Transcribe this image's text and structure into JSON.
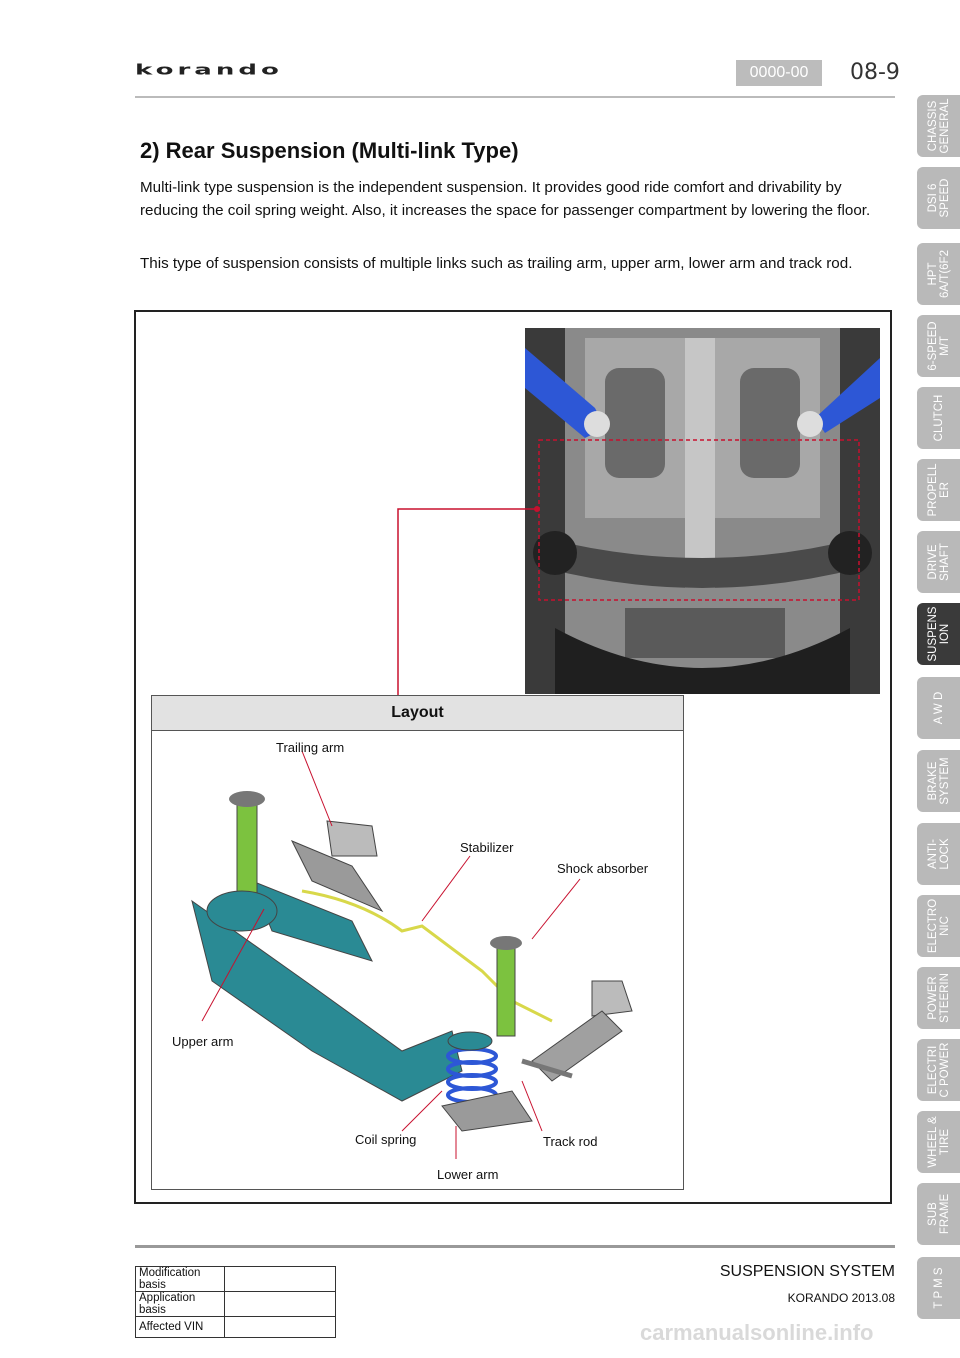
{
  "header": {
    "logo": "korando",
    "code": "0000-00",
    "page": "08-9"
  },
  "section": {
    "title": "2) Rear Suspension (Multi-link Type)",
    "para1": "Multi-link type suspension is the independent suspension. It provides good ride comfort and drivability by reducing the coil spring weight. Also, it increases the space for passenger compartment by lowering the floor.",
    "para2": "This type of suspension consists of multiple links such as trailing arm, upper arm, lower arm and track rod."
  },
  "figure": {
    "layout_title": "Layout",
    "labels": {
      "trailing_arm": "Trailing arm",
      "stabilizer": "Stabilizer",
      "shock_absorber": "Shock absorber",
      "upper_arm": "Upper arm",
      "coil_spring": "Coil spring",
      "track_rod": "Track rod",
      "lower_arm": "Lower arm"
    }
  },
  "side_tabs": [
    "CHASSIS\nGENERAL",
    "DSI 6\nSPEED",
    "HPT\n6A/T(6F2",
    "6-SPEED\nM/T",
    "CLUTCH",
    "PROPELL\nER",
    "DRIVE\nSHAFT",
    "SUSPENS\nION",
    "A W D",
    "BRAKE\nSYSTEM",
    "ANTI-\nLOCK",
    "ELECTRO\nNIC",
    "POWER\nSTEERIN",
    "ELECTRI\nC POWER",
    "WHEEL &\nTIRE",
    "SUB\nFRAME",
    "T P M S"
  ],
  "active_tab": "SUSPENS\nION",
  "footer": {
    "title": "SUSPENSION SYSTEM",
    "subtitle": "KORANDO 2013.08",
    "rows": [
      {
        "key": "Modification basis",
        "value": ""
      },
      {
        "key": "Application basis",
        "value": ""
      },
      {
        "key": "Affected VIN",
        "value": ""
      }
    ]
  },
  "watermark": "carmanualsonline.info",
  "colors": {
    "tab_bg": "#b9b9b9",
    "tab_active": "#3a3a3a",
    "callout_red": "#c8102e",
    "code_badge": "#bcbcbc"
  }
}
